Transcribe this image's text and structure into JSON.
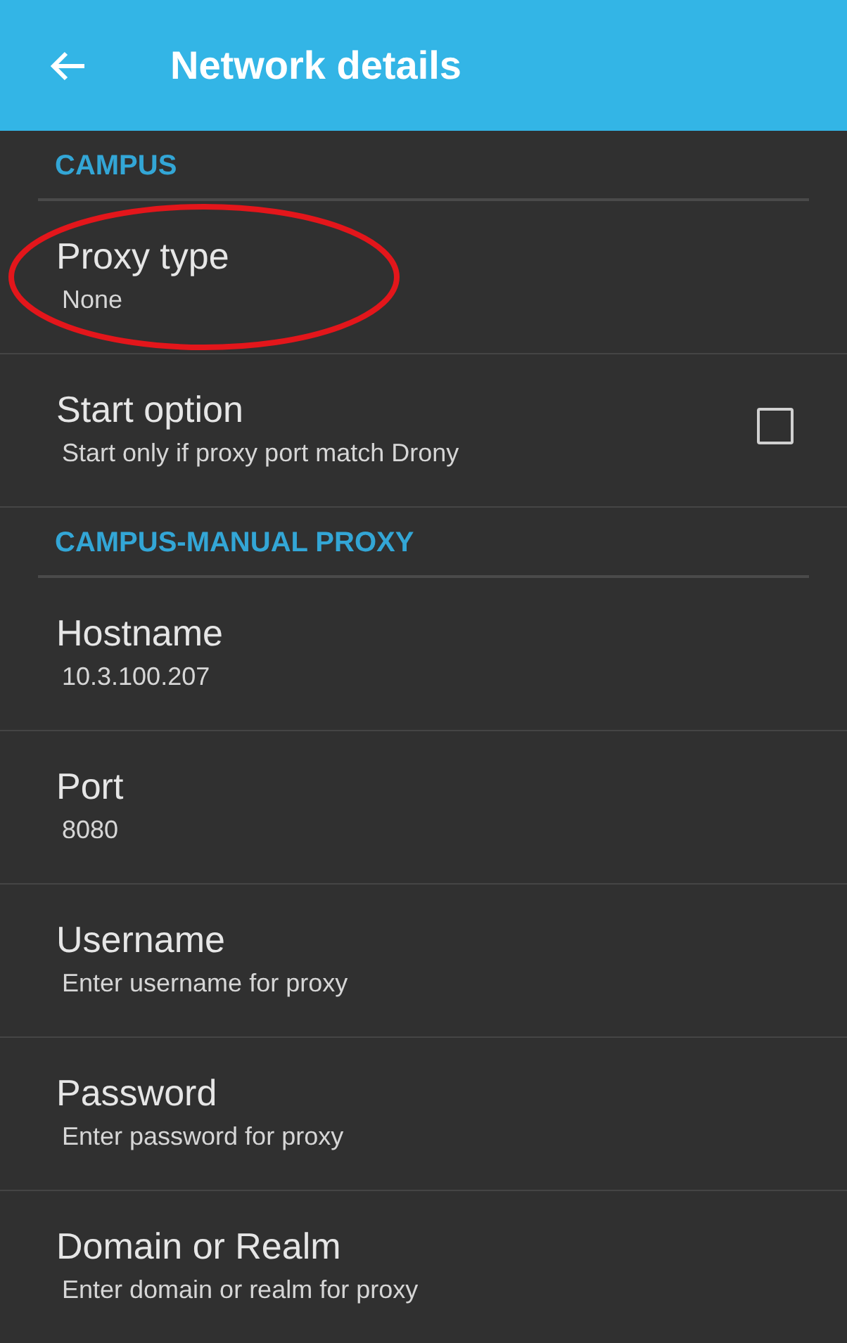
{
  "app_bar": {
    "title": "Network details"
  },
  "sections": [
    {
      "title": "CAMPUS",
      "items": [
        {
          "kind": "text",
          "title": "Proxy type",
          "summary": "None",
          "circled": true
        },
        {
          "kind": "checkbox",
          "title": "Start option",
          "summary": "Start only if proxy port match Drony",
          "checked": false,
          "circled": false
        }
      ]
    },
    {
      "title": "CAMPUS-MANUAL PROXY",
      "items": [
        {
          "kind": "text",
          "title": "Hostname",
          "summary": "10.3.100.207",
          "circled": false
        },
        {
          "kind": "text",
          "title": "Port",
          "summary": "8080",
          "circled": false
        },
        {
          "kind": "text",
          "title": "Username",
          "summary": "Enter username for proxy",
          "circled": false
        },
        {
          "kind": "text",
          "title": "Password",
          "summary": "Enter password for proxy",
          "circled": false
        },
        {
          "kind": "text",
          "title": "Domain or Realm",
          "summary": "Enter domain or realm for proxy",
          "circled": false
        }
      ]
    }
  ]
}
